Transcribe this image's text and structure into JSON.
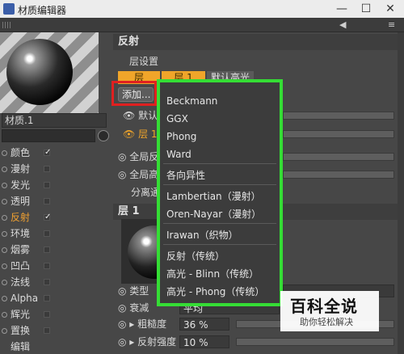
{
  "window": {
    "title": "材质编辑器",
    "minimize": "—",
    "maximize": "☐",
    "close": "✕"
  },
  "toolbar": {
    "arrow_tool": "◀",
    "more": "≡"
  },
  "material": {
    "name": "材质.1"
  },
  "channels": [
    {
      "label": "颜色",
      "checked": true
    },
    {
      "label": "漫射",
      "checked": false
    },
    {
      "label": "发光",
      "checked": false
    },
    {
      "label": "透明",
      "checked": false
    },
    {
      "label": "反射",
      "checked": true,
      "active": true
    },
    {
      "label": "环境",
      "checked": false
    },
    {
      "label": "烟雾",
      "checked": false
    },
    {
      "label": "凹凸",
      "checked": false
    },
    {
      "label": "法线",
      "checked": false
    },
    {
      "label": "Alpha",
      "checked": false
    },
    {
      "label": "辉光",
      "checked": false
    },
    {
      "label": "置换",
      "checked": false
    },
    {
      "label": "编辑"
    }
  ],
  "reflect": {
    "header": "反射",
    "layer_settings": "层设置",
    "tabs": [
      "层",
      "层 1",
      "默认高光"
    ],
    "add_button": "添加...",
    "default_row": "默认",
    "layer1_row": "层 1",
    "global_reflect": "全局反",
    "global_highlight": "全局高",
    "separate": "分离通"
  },
  "layer": {
    "header": "层 1",
    "type_label": "类型",
    "atten_label": "衰减",
    "atten_value": "平均",
    "roughness_label": "粗糙度",
    "roughness_value": "36 %",
    "reflect_strength_label": "反射强度",
    "reflect_strength_value": "10 %"
  },
  "dropdown": {
    "items": [
      "Beckmann",
      "GGX",
      "Phong",
      "Ward",
      "各向异性",
      "Lambertian（漫射）",
      "Oren-Nayar（漫射）",
      "Irawan（织物）",
      "反射（传统）",
      "高光 - Blinn（传统）",
      "高光 - Phong（传统）"
    ]
  },
  "watermark": {
    "title": "百科全说",
    "subtitle": "助你轻松解决"
  },
  "colors": {
    "accent_orange": "#f0a52a",
    "highlight_green": "#35dd35",
    "highlight_red": "#e02020"
  }
}
